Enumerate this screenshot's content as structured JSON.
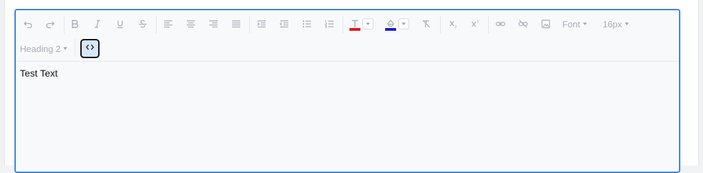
{
  "toolbar": {
    "font_label": "Font",
    "size_label": "16px",
    "heading_label": "Heading 2",
    "colors": {
      "text_color": "#e8141c",
      "highlight_color": "#1a1ad8",
      "accent": "#3c83d6"
    },
    "icons": [
      "undo-icon",
      "redo-icon",
      "bold-icon",
      "italic-icon",
      "underline-icon",
      "strikethrough-icon",
      "align-left-icon",
      "align-center-icon",
      "align-right-icon",
      "align-justify-icon",
      "indent-icon",
      "outdent-icon",
      "bullet-list-icon",
      "numbered-list-icon",
      "text-color-icon",
      "highlight-color-icon",
      "clear-format-icon",
      "subscript-icon",
      "superscript-icon",
      "link-icon",
      "unlink-icon",
      "image-icon",
      "source-code-icon"
    ]
  },
  "editor": {
    "content": "Test Text"
  }
}
